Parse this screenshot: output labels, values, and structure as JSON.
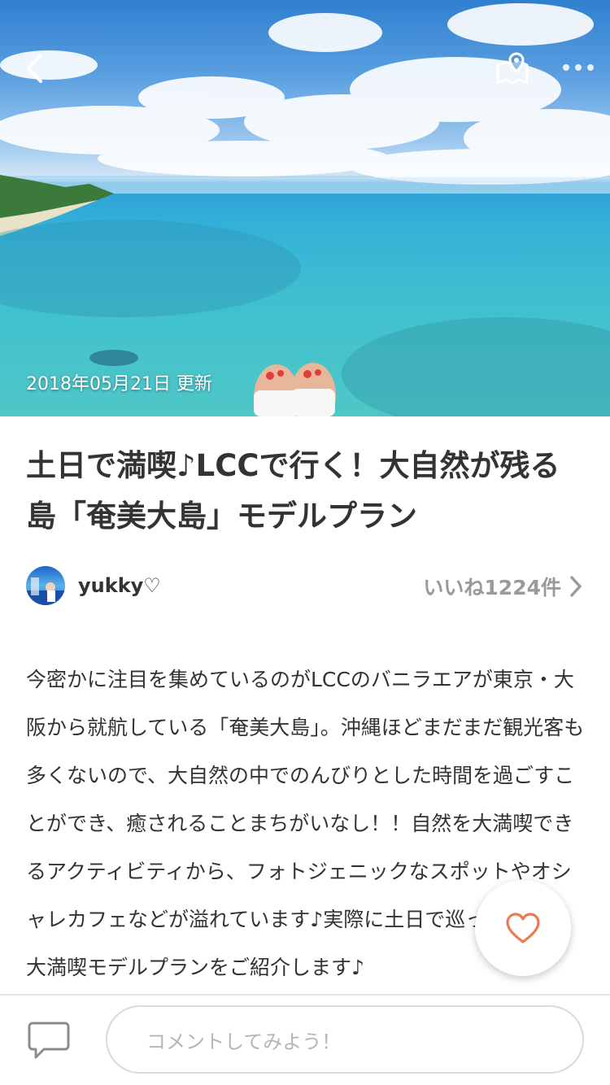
{
  "hero": {
    "updated_date": "2018年05月21日 更新"
  },
  "article": {
    "title": "土日で満喫♪LCCで行く！大自然が残る島「奄美大島」モデルプラン",
    "author": "yukky♡",
    "likes_label": "いいね1224件",
    "body": "今密かに注目を集めているのがLCCのバニラエアが東京・大阪から就航している「奄美大島」。沖縄ほどまだまだ観光客も多くないので、大自然の中でのんびりとした時間を過ごすことができ、癒されることまちがいなし！！自然を大満喫できるアクティビティから、フォトジェニックなスポットやオシャレカフェなどが溢れています♪実際に土日で巡った弾丸＆大満喫モデルプランをご紹介します♪"
  },
  "comment_bar": {
    "placeholder": "コメントしてみよう！"
  },
  "icons": {
    "back": "chevron-left-icon",
    "map": "map-pin-icon",
    "more": "more-horizontal-icon",
    "like": "heart-icon",
    "comment": "speech-bubble-icon"
  },
  "colors": {
    "like_accent": "#ee7a52",
    "secondary_text": "#9a9a9a"
  }
}
